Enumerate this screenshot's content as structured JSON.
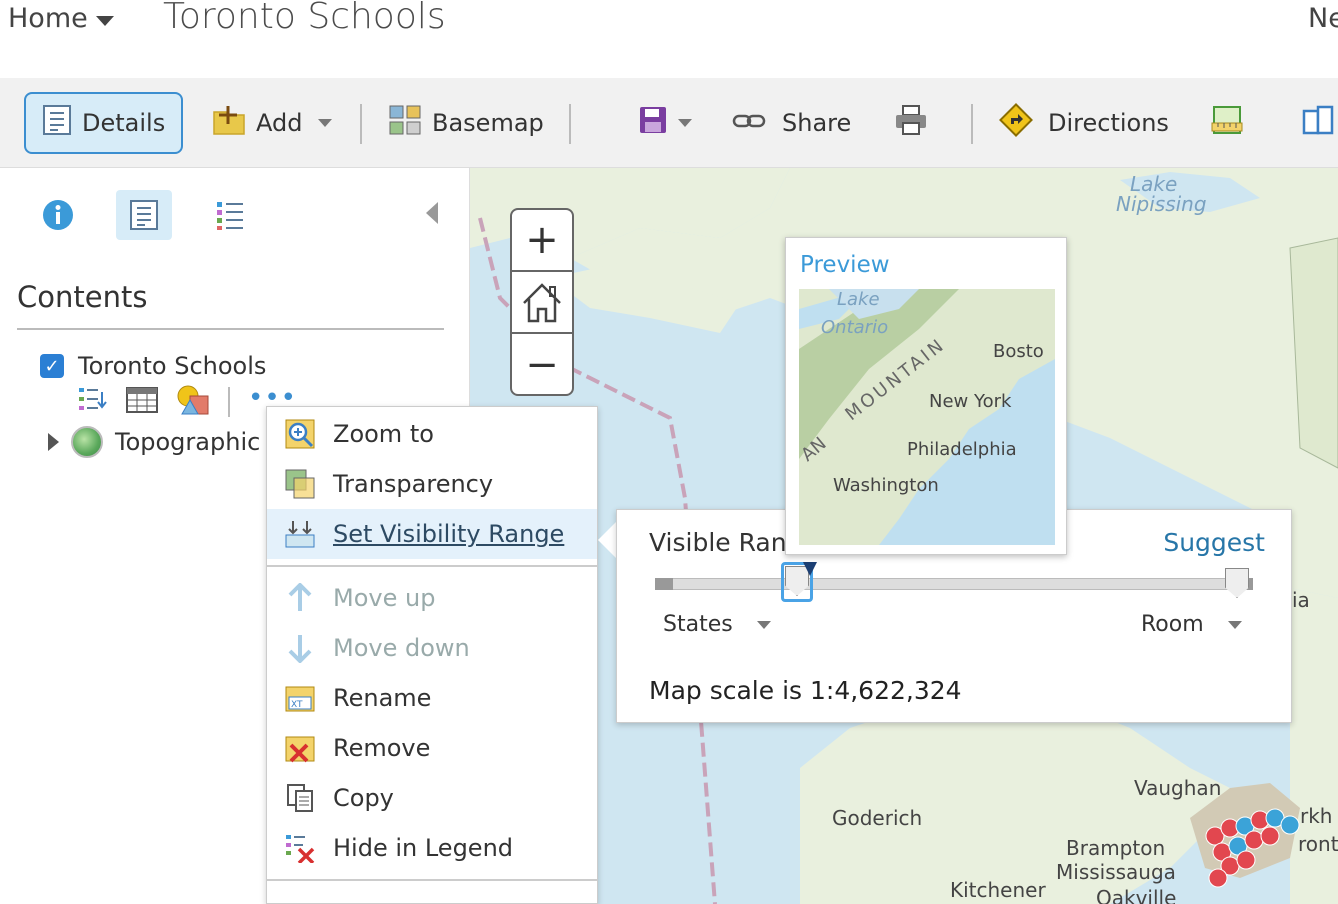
{
  "header": {
    "home_label": "Home",
    "title": "Toronto Schools",
    "right_text": "Ne"
  },
  "toolbar": {
    "details_label": "Details",
    "add_label": "Add",
    "basemap_label": "Basemap",
    "share_label": "Share",
    "directions_label": "Directions"
  },
  "panel": {
    "contents_title": "Contents",
    "layer_name": "Toronto Schools",
    "basemap_name": "Topographic"
  },
  "context_menu": {
    "items": [
      {
        "label": "Zoom to"
      },
      {
        "label": "Transparency"
      },
      {
        "label": "Set Visibility Range"
      },
      {
        "label": "Move up"
      },
      {
        "label": "Move down"
      },
      {
        "label": "Rename"
      },
      {
        "label": "Remove"
      },
      {
        "label": "Copy"
      },
      {
        "label": "Hide in Legend"
      }
    ]
  },
  "visible_range": {
    "title": "Visible Ran",
    "suggest_label": "Suggest",
    "min_scale": "States",
    "max_scale": "Room",
    "scale_text": "Map scale is 1:4,622,324"
  },
  "preview": {
    "title": "Preview",
    "labels": {
      "lake": "Lake",
      "ontario": "Ontario",
      "mountain": "MOUNTAIN",
      "boston": "Bosto",
      "new_york": "New York",
      "philadelphia": "Philadelphia",
      "washington": "Washington",
      "an": "AN"
    }
  },
  "map_labels": {
    "lake_nipissing_1": "Lake",
    "lake_nipissing_2": "Nipissing",
    "vaughan": "Vaughan",
    "goderich": "Goderich",
    "brampton": "Brampton",
    "mississauga": "Mississauga",
    "kitchener": "Kitchener",
    "oakville": "Oakville",
    "markham": "rkh",
    "toronto": "ront",
    "ia": "ia"
  },
  "colors": {
    "accent": "#3b8ed0",
    "active_bg": "#d7ecf8",
    "link": "#2776a8",
    "map_water": "#cfe6f1",
    "map_land": "#e9f0de"
  }
}
